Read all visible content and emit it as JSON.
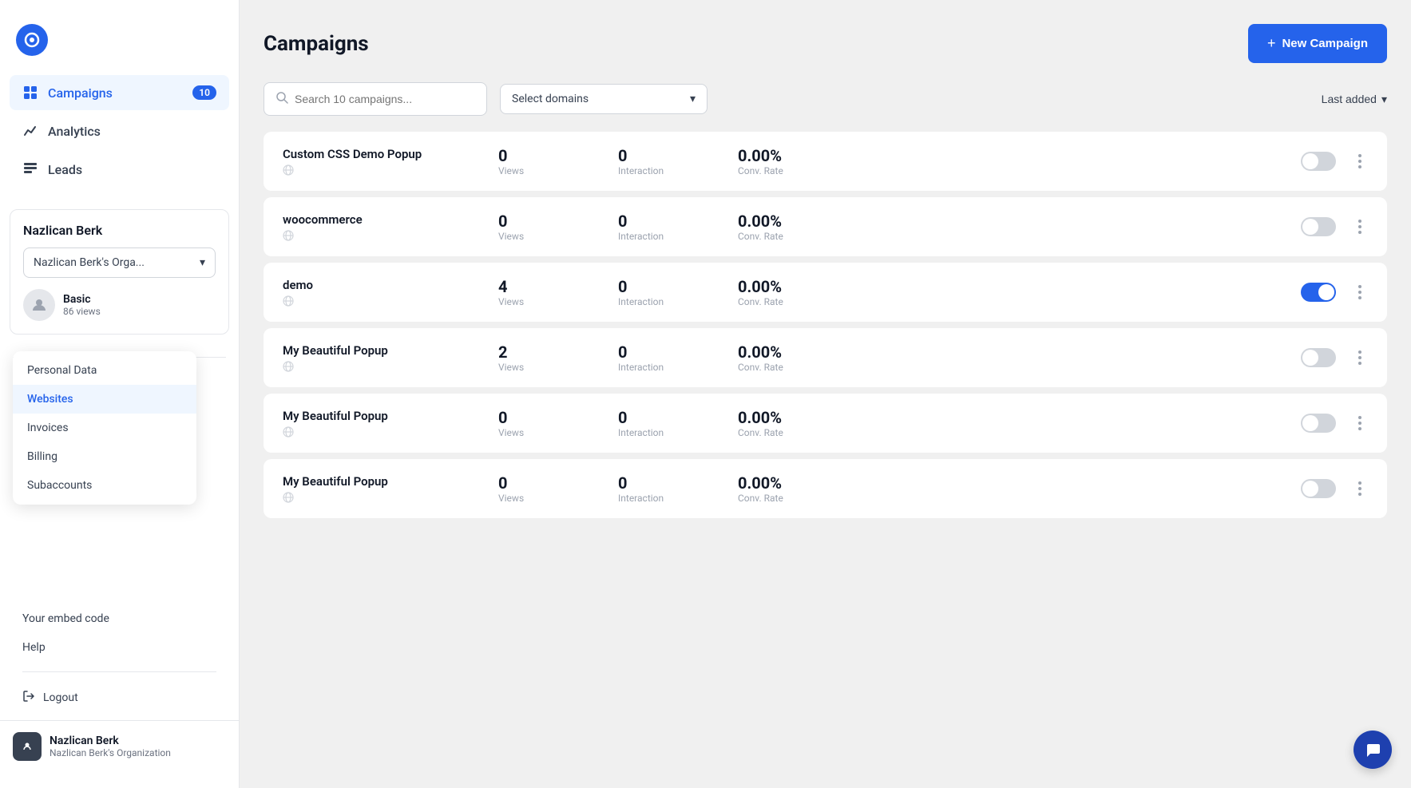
{
  "sidebar": {
    "logo_initial": "●",
    "nav_items": [
      {
        "id": "campaigns",
        "label": "Campaigns",
        "badge": "10",
        "active": true
      },
      {
        "id": "analytics",
        "label": "Analytics",
        "badge": null,
        "active": false
      },
      {
        "id": "leads",
        "label": "Leads",
        "badge": null,
        "active": false
      }
    ],
    "profile": {
      "name": "Nazlican Berk",
      "org": "Nazlican Berk's Orga...",
      "plan": "Basic",
      "views": "86 views"
    },
    "menu_items": [
      {
        "id": "personal-data",
        "label": "Personal Data"
      },
      {
        "id": "websites",
        "label": "Websites",
        "active": true
      },
      {
        "id": "invoices",
        "label": "Invoices"
      },
      {
        "id": "billing",
        "label": "Billing"
      },
      {
        "id": "subaccounts",
        "label": "Subaccounts"
      }
    ],
    "bottom_links": [
      {
        "id": "embed-code",
        "label": "Your embed code"
      },
      {
        "id": "help",
        "label": "Help"
      }
    ],
    "logout_label": "Logout",
    "user_footer": {
      "name": "Nazlican Berk",
      "org": "Nazlican Berk's Organization"
    }
  },
  "header": {
    "title": "Campaigns",
    "new_campaign_label": "New Campaign"
  },
  "filters": {
    "search_placeholder": "Search 10 campaigns...",
    "domain_select_placeholder": "Select domains",
    "sort_label": "Last added"
  },
  "campaigns": [
    {
      "name": "Custom CSS Demo Popup",
      "views": "0",
      "views_label": "Views",
      "interaction": "0",
      "interaction_label": "Interaction",
      "conv_rate": "0.00%",
      "conv_rate_label": "Conv. Rate",
      "enabled": false
    },
    {
      "name": "woocommerce",
      "views": "0",
      "views_label": "Views",
      "interaction": "0",
      "interaction_label": "Interaction",
      "conv_rate": "0.00%",
      "conv_rate_label": "Conv. Rate",
      "enabled": false
    },
    {
      "name": "demo",
      "views": "4",
      "views_label": "Views",
      "interaction": "0",
      "interaction_label": "Interaction",
      "conv_rate": "0.00%",
      "conv_rate_label": "Conv. Rate",
      "enabled": true
    },
    {
      "name": "My Beautiful Popup",
      "views": "2",
      "views_label": "Views",
      "interaction": "0",
      "interaction_label": "Interaction",
      "conv_rate": "0.00%",
      "conv_rate_label": "Conv. Rate",
      "enabled": false
    },
    {
      "name": "My Beautiful Popup",
      "views": "0",
      "views_label": "Views",
      "interaction": "0",
      "interaction_label": "Interaction",
      "conv_rate": "0.00%",
      "conv_rate_label": "Conv. Rate",
      "enabled": false
    },
    {
      "name": "My Beautiful Popup",
      "views": "0",
      "views_label": "Views",
      "interaction": "0",
      "interaction_label": "Interaction",
      "conv_rate": "0.00%",
      "conv_rate_label": "Conv. Rate",
      "enabled": false
    }
  ]
}
